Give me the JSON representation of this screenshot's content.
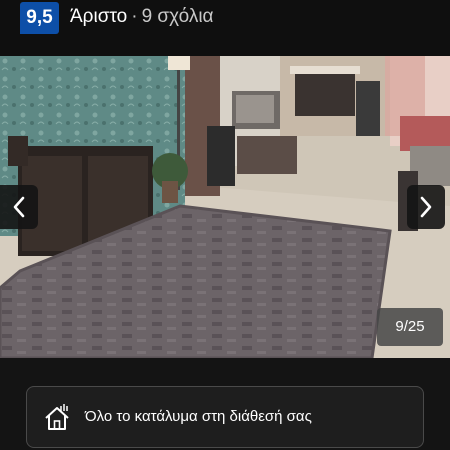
{
  "header": {
    "score": "9,5",
    "rating_label": "Άριστο",
    "separator": "·",
    "reviews": "9 σχόλια"
  },
  "gallery": {
    "counter": "9/25",
    "prev_icon": "chevron-left-icon",
    "next_icon": "chevron-right-icon"
  },
  "feature": {
    "icon": "house-icon",
    "text": "Όλο το κατάλυμα στη διάθεσή σας"
  },
  "colors": {
    "score_badge": "#0d4fa8",
    "background": "#111111"
  }
}
